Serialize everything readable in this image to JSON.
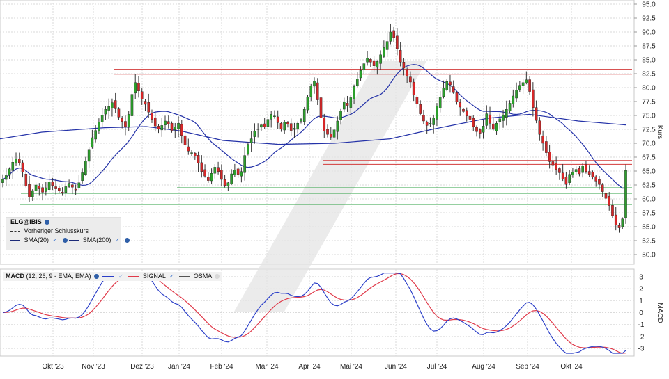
{
  "chart_data": [
    {
      "type": "candlestick",
      "symbol": "ELG@IBIS",
      "ylabel": "Kurs",
      "ylim": [
        49,
        96
      ],
      "yticks": [
        "95.0",
        "92.5",
        "90.0",
        "87.5",
        "85.0",
        "82.5",
        "80.0",
        "77.5",
        "75.0",
        "72.5",
        "70.0",
        "67.5",
        "65.0",
        "62.5",
        "60.0",
        "57.5",
        "55.0",
        "52.5",
        "50.0"
      ],
      "x_ticks": [
        "Okt '23",
        "Nov '23",
        "Dez '23",
        "Jan '24",
        "Feb '24",
        "Mär '24",
        "Apr '24",
        "Mai '24",
        "Jun '24",
        "Jul '24",
        "Aug '24",
        "Sep '24",
        "Okt '24"
      ],
      "legend": {
        "title": "ELG@IBIS",
        "items": [
          "Vorheriger Schlusskurs",
          "SMA(20)",
          "SMA(200)"
        ]
      },
      "candles_close": [
        63.5,
        64.2,
        65.4,
        66.6,
        67.2,
        66.5,
        64.8,
        62.3,
        60.3,
        61.5,
        62.5,
        61.8,
        61.2,
        62.0,
        63.1,
        62.4,
        61.8,
        61.5,
        61.1,
        62.2,
        62.8,
        62.1,
        61.6,
        62.9,
        64.7,
        66.8,
        68.9,
        71.0,
        72.3,
        73.8,
        75.1,
        76.1,
        76.6,
        77.3,
        76.2,
        74.7,
        73.9,
        73.0,
        75.2,
        78.8,
        80.9,
        79.4,
        77.9,
        77.0,
        75.6,
        74.3,
        73.1,
        72.6,
        73.2,
        74.0,
        73.4,
        72.3,
        72.9,
        73.6,
        71.4,
        69.7,
        68.6,
        68.3,
        67.7,
        66.4,
        64.9,
        64.1,
        63.3,
        64.6,
        65.7,
        64.9,
        63.5,
        62.4,
        62.9,
        64.5,
        65.2,
        64.4,
        64.9,
        67.8,
        69.8,
        70.8,
        72.2,
        72.6,
        73.3,
        72.9,
        74.3,
        75.2,
        74.9,
        73.7,
        72.6,
        73.8,
        73.4,
        72.3,
        72.7,
        73.6,
        74.3,
        76.1,
        78.3,
        80.3,
        81.2,
        77.8,
        74.6,
        72.2,
        71.6,
        71.1,
        72.4,
        74.0,
        75.8,
        77.4,
        76.8,
        78.2,
        80.2,
        81.6,
        83.1,
        84.3,
        85.3,
        84.6,
        83.9,
        84.7,
        85.9,
        87.2,
        88.3,
        90.0,
        89.0,
        87.0,
        84.6,
        83.5,
        82.1,
        81.0,
        78.7,
        77.1,
        75.3,
        74.0,
        73.2,
        73.6,
        74.6,
        76.7,
        78.3,
        79.9,
        81.1,
        80.5,
        79.1,
        77.4,
        76.5,
        75.7,
        74.9,
        74.3,
        73.0,
        72.1,
        71.8,
        73.1,
        75.3,
        73.6,
        72.5,
        73.6,
        74.4,
        75.0,
        76.1,
        77.2,
        78.5,
        79.6,
        80.4,
        80.9,
        81.4,
        79.3,
        76.4,
        74.1,
        71.6,
        70.0,
        68.3,
        66.7,
        66.1,
        65.3,
        64.7,
        63.6,
        62.6,
        64.4,
        64.8,
        65.3,
        64.5,
        65.9,
        64.9,
        64.4,
        63.9,
        63.2,
        62.6,
        61.3,
        60.1,
        58.8,
        57.0,
        55.3,
        54.8,
        56.4,
        65.1
      ]
    },
    {
      "type": "line",
      "title": "MACD",
      "params": "(12, 26, 9 - EMA, EMA)",
      "ylabel": "MACD",
      "ylim": [
        -3.5,
        3.5
      ],
      "yticks": [
        "3",
        "2",
        "1",
        "0",
        "-1",
        "-2",
        "-3"
      ],
      "series": [
        {
          "name": "MACD",
          "color": "#2b3fc8"
        },
        {
          "name": "SIGNAL",
          "color": "#e03a4a"
        },
        {
          "name": "OSMA",
          "color": "#555555"
        }
      ]
    }
  ]
}
